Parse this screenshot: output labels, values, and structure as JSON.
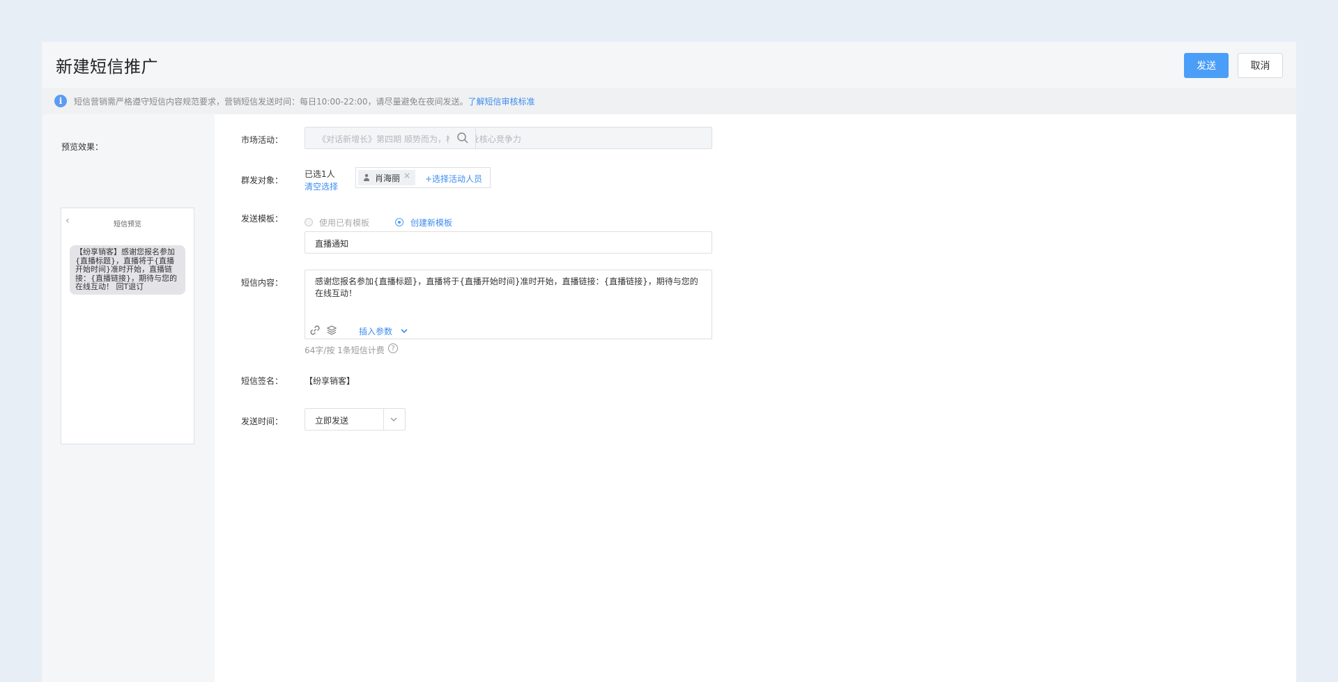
{
  "header": {
    "title": "新建短信推广",
    "send_label": "发送",
    "cancel_label": "取消"
  },
  "notice": {
    "text": "短信营销需严格遵守短信内容规范要求，营销短信发送时间：每日10:00-22:00，请尽量避免在夜间发送。",
    "link": "了解短信审核标准"
  },
  "preview": {
    "label": "预览效果：",
    "phone_title": "短信预览",
    "message": "【纷享销客】感谢您报名参加{直播标题}，直播将于{直播开始时间}准时开始，直播链接：{直播链接}，期待与您的在线互动！ 回T退订"
  },
  "form": {
    "market": {
      "label": "市场活动：",
      "placeholder": "《对话新增长》第四期 顺势而为，构建企业核心竞争力"
    },
    "target": {
      "label": "群发对象：",
      "selected_count": "已选1人",
      "clear": "清空选择",
      "tag": "肖海丽",
      "tag_close": "×",
      "add": "+选择活动人员"
    },
    "template": {
      "label": "发送模板：",
      "option_existing": "使用已有模板",
      "option_new": "创建新模板",
      "selected": "创建新模板",
      "name": "直播通知"
    },
    "content": {
      "label": "短信内容：",
      "text": "感谢您报名参加{直播标题}，直播将于{直播开始时间}准时开始，直播链接：{直播链接}，期待与您的在线互动！",
      "insert_param": "插入参数",
      "count": "64字/按 1条短信计费"
    },
    "signature": {
      "label": "短信签名：",
      "value": "【纷享销客】"
    },
    "send_time": {
      "label": "发送时间：",
      "value": "立即发送"
    }
  },
  "colors": {
    "accent": "#4a9ef8",
    "link": "#3d8cf0",
    "background": "#e8eef6"
  }
}
